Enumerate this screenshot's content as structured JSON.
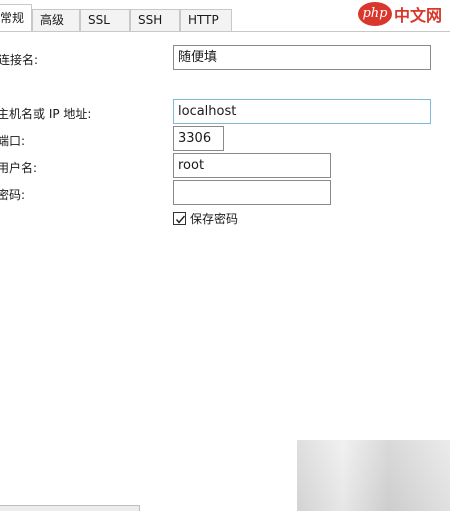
{
  "tabs": [
    {
      "label": "常规",
      "active": true
    },
    {
      "label": "高级",
      "active": false
    },
    {
      "label": "SSL",
      "active": false
    },
    {
      "label": "SSH",
      "active": false
    },
    {
      "label": "HTTP",
      "active": false
    }
  ],
  "form": {
    "connection_name": {
      "label": "连接名:",
      "value": "随便填"
    },
    "host": {
      "label": "主机名或 IP 地址:",
      "value": "localhost"
    },
    "port": {
      "label": "端口:",
      "value": "3306"
    },
    "username": {
      "label": "用户名:",
      "value": "root"
    },
    "password": {
      "label": "密码:",
      "value": ""
    },
    "save_password": {
      "label": "保存密码",
      "checked": true
    }
  },
  "watermark": {
    "logo": "php",
    "text": "中文网"
  },
  "colors": {
    "watermark": "#d9372b",
    "focus_border": "#7fb9d6"
  }
}
